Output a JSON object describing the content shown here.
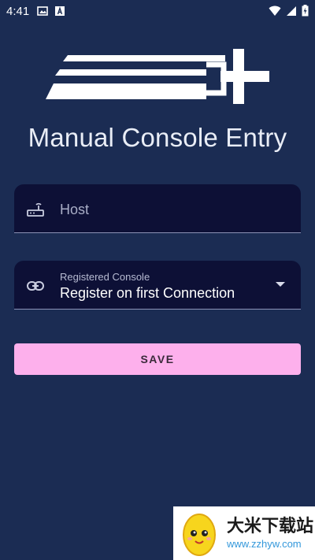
{
  "status_bar": {
    "time": "4:41"
  },
  "header": {
    "title": "Manual Console Entry"
  },
  "host_field": {
    "placeholder": "Host"
  },
  "console_field": {
    "label": "Registered Console",
    "value": "Register on first Connection"
  },
  "save_button": {
    "label": "SAVE"
  },
  "watermark": {
    "text_cn": "大米下载站",
    "url": "www.zzhyw.com"
  },
  "colors": {
    "background": "#1b2c53",
    "field_bg": "#0d1036",
    "button_bg": "#fdb0ec"
  }
}
